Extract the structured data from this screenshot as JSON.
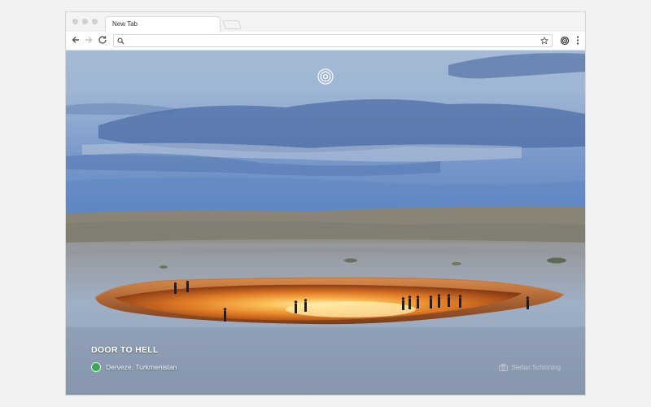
{
  "browser": {
    "tab_title": "New Tab",
    "omnibox": {
      "value": "",
      "placeholder": ""
    }
  },
  "icons": {
    "back": "arrow-left-icon",
    "forward": "arrow-right-icon",
    "reload": "reload-icon",
    "search": "search-icon",
    "bookmark": "star-icon",
    "extension": "extension-icon",
    "menu": "kebab-menu-icon",
    "center": "target-icon",
    "location": "location-badge-icon",
    "camera": "camera-icon"
  },
  "photo": {
    "title": "DOOR TO HELL",
    "location": "Derveze, Turkmenistan",
    "credit": "Stefan Schinning"
  },
  "colors": {
    "sky_top": "#a8bfdb",
    "sky_mid": "#6f8fc2",
    "sky_horizon": "#5f86c2",
    "ground": "#8a96a8",
    "fire": "#f08a28",
    "fire_core": "#fde39a"
  }
}
